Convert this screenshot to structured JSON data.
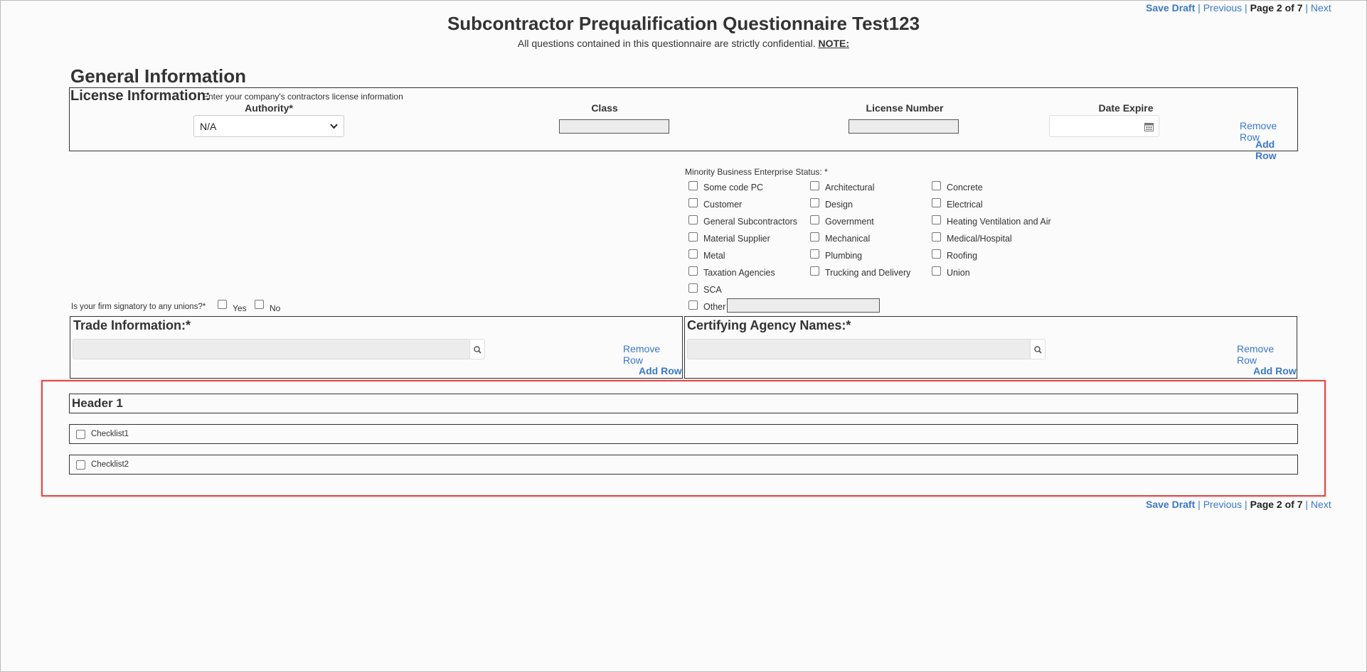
{
  "pager": {
    "save_draft": "Save Draft",
    "sep1": "|",
    "previous": "Previous",
    "sep2": "|",
    "page_label": "Page 2 of 7",
    "sep3": "|",
    "next": "Next"
  },
  "title": "Subcontractor Prequalification Questionnaire Test123",
  "subtitle": "All questions contained in this questionnaire are strictly confidential.",
  "subtitle_note": "NOTE:",
  "section_title": "General Information",
  "license": {
    "title": "License Information:",
    "hint": "Enter your company's contractors license information",
    "col_authority": "Authority*",
    "col_class": "Class",
    "col_license_number": "License Number",
    "col_date_expire": "Date Expire",
    "authority_value": "N/A",
    "class_value": "",
    "license_number_value": "",
    "date_expire_value": "",
    "remove_row": "Remove Row",
    "add_row": "Add Row"
  },
  "mbe": {
    "label": "Minority Business Enterprise Status: *",
    "col1": [
      "Some code PC",
      "Customer",
      "General Subcontractors",
      "Material Supplier",
      "Metal",
      "Taxation Agencies",
      "SCA",
      "Other"
    ],
    "col2": [
      "Architectural",
      "Design",
      "Government",
      "Mechanical",
      "Plumbing",
      "Trucking and Delivery"
    ],
    "col3": [
      "Concrete",
      "Electrical",
      "Heating Ventilation and Air",
      "Medical/Hospital",
      "Roofing",
      "Union"
    ],
    "other_value": ""
  },
  "unions": {
    "question": "Is your firm signatory to any unions?*",
    "yes": "Yes",
    "no": "No"
  },
  "trade": {
    "title": "Trade Information:*",
    "remove_row": "Remove Row",
    "add_row": "Add Row",
    "search_value": ""
  },
  "agency": {
    "title": "Certifying Agency Names:*",
    "remove_row": "Remove Row",
    "add_row": "Add Row",
    "search_value": ""
  },
  "header1": "Header 1",
  "checklists": [
    "Checklist1",
    "Checklist2"
  ],
  "icons": {
    "chevron": "chevron-down-icon",
    "calendar": "calendar-icon",
    "search": "search-icon"
  },
  "colors": {
    "link": "#3a78c9",
    "highlight": "#e04848"
  }
}
